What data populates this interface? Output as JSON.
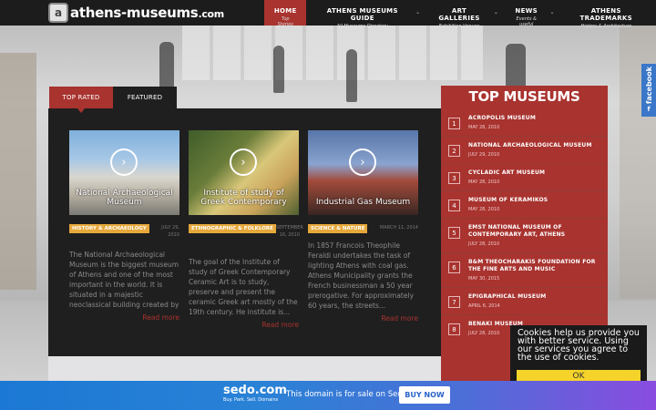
{
  "logo": {
    "badge": "a",
    "name": "athens-museums",
    "tld": ".com"
  },
  "nav": [
    {
      "label": "HOME",
      "sub": "Top Stories",
      "active": true,
      "caret": ""
    },
    {
      "label": "ATHENS MUSEUMS GUIDE",
      "sub": "All Museums Directory",
      "active": false,
      "caret": "⌄"
    },
    {
      "label": "ART GALLERIES",
      "sub": "Exhibition Venues",
      "active": false,
      "caret": "⌄"
    },
    {
      "label": "NEWS",
      "sub": "Events & useful",
      "active": false,
      "caret": "⌄"
    },
    {
      "label": "ATHENS TRADEMARKS",
      "sub": "History & Architecture",
      "active": false,
      "caret": ""
    }
  ],
  "facebook": {
    "label": "facebook",
    "icon": "f"
  },
  "tabs": {
    "top_rated": "TOP RATED",
    "featured": "FEATURED"
  },
  "cards": [
    {
      "thumb_title": "National Archaeological Museum",
      "category": "HISTORY & ARCHAEOLOGY",
      "date": "JULY 29, 2010",
      "excerpt": "The National Archaeological Museum is the biggest museum of Athens and one of the most important in the world. It is situated in a majestic neoclassical building created by L...",
      "read_more": "Read more"
    },
    {
      "thumb_title": "Institute of study of Greek Contemporary",
      "category": "ETHNOGRAPHIC & FOLKLORE",
      "date": "SEPTEMBER 16, 2010",
      "excerpt": "The goal of the Institute of study of Greek Contemporary Ceramic Art is to study, preserve and present the ceramic Greek art mostly of the 19th century. He institute is...",
      "read_more": "Read more"
    },
    {
      "thumb_title": "Industrial Gas Museum",
      "category": "SCIENCE & NATURE",
      "date": "MARCH 11, 2014",
      "excerpt": "In 1857 Francois Theophile Feraldi undertakes the task of lighting Athens with coal gas. Athens Municipality grants the French businessman a 50 year prerogative. For approximately 60 years, the streets...",
      "read_more": "Read more"
    }
  ],
  "sidebar": {
    "title": "TOP MUSEUMS",
    "items": [
      {
        "num": "1",
        "title": "ACROPOLIS MUSEUM",
        "date": "MAY 28, 2010"
      },
      {
        "num": "2",
        "title": "NATIONAL ARCHAEOLOGICAL MUSEUM",
        "date": "JULY 29, 2010"
      },
      {
        "num": "3",
        "title": "CYCLADIC ART MUSEUM",
        "date": "MAY 28, 2010"
      },
      {
        "num": "4",
        "title": "MUSEUM OF KERAMIKOS",
        "date": "MAY 28, 2010"
      },
      {
        "num": "5",
        "title": "EMST NATIONAL MUSEUM OF CONTEMPORARY ART, ATHENS",
        "date": "JULY 28, 2010"
      },
      {
        "num": "6",
        "title": "B&M THEOCHARAKIS FOUNDATION FOR THE FINE ARTS AND MUSIC",
        "date": "MAY 30, 2015"
      },
      {
        "num": "7",
        "title": "EPIGRAPHICAL MUSEUM",
        "date": "APRIL 6, 2014"
      },
      {
        "num": "8",
        "title": "BENAKI MUSEUM",
        "date": "JULY 28, 2010"
      }
    ]
  },
  "cookie": {
    "text": "Cookies help us provide you with better service. Using our services you agree to the use of cookies.",
    "ok": "OK"
  },
  "sedo": {
    "name": "sedo.com",
    "tagline": "Buy. Park. Sell. Domains",
    "message": "This domain is for sale on Sedo",
    "button": "BUY NOW"
  }
}
